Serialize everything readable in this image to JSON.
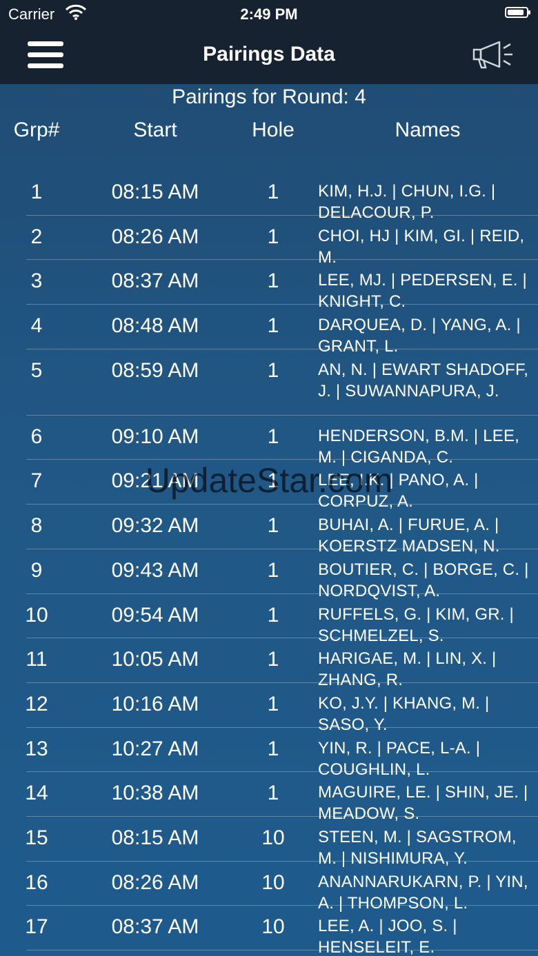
{
  "status": {
    "carrier": "Carrier",
    "time": "2:49 PM",
    "battery_level": 0.9
  },
  "nav": {
    "title": "Pairings Data",
    "menu_icon": "hamburger-menu-icon",
    "announce_icon": "megaphone-icon"
  },
  "round_title": "Pairings for Round: 4",
  "columns": {
    "grp": "Grp#",
    "start": "Start",
    "hole": "Hole",
    "names": "Names"
  },
  "pairings": [
    {
      "grp": "1",
      "start": "08:15 AM",
      "hole": "1",
      "names": "KIM, H.J. | CHUN, I.G. | DELACOUR, P."
    },
    {
      "grp": "2",
      "start": "08:26 AM",
      "hole": "1",
      "names": "CHOI, HJ | KIM, GI. | REID, M."
    },
    {
      "grp": "3",
      "start": "08:37 AM",
      "hole": "1",
      "names": "LEE, MJ. | PEDERSEN, E. | KNIGHT, C."
    },
    {
      "grp": "4",
      "start": "08:48 AM",
      "hole": "1",
      "names": "DARQUEA, D. | YANG, A. | GRANT, L."
    },
    {
      "grp": "5",
      "start": "08:59 AM",
      "hole": "1",
      "names": "AN, N. | EWART SHADOFF, J. | SUWANNAPURA, J."
    },
    {
      "grp": "6",
      "start": "09:10 AM",
      "hole": "1",
      "names": "HENDERSON, B.M. | LEE, M. | CIGANDA, C."
    },
    {
      "grp": "7",
      "start": "09:21 AM",
      "hole": "1",
      "names": "LEE, I.K. | PANO, A. | CORPUZ, A."
    },
    {
      "grp": "8",
      "start": "09:32 AM",
      "hole": "1",
      "names": "BUHAI, A. | FURUE, A. | KOERSTZ MADSEN, N."
    },
    {
      "grp": "9",
      "start": "09:43 AM",
      "hole": "1",
      "names": "BOUTIER, C. | BORGE, C. | NORDQVIST, A."
    },
    {
      "grp": "10",
      "start": "09:54 AM",
      "hole": "1",
      "names": "RUFFELS, G. | KIM, GR. | SCHMELZEL, S."
    },
    {
      "grp": "11",
      "start": "10:05 AM",
      "hole": "1",
      "names": "HARIGAE, M. | LIN, X. | ZHANG, R."
    },
    {
      "grp": "12",
      "start": "10:16 AM",
      "hole": "1",
      "names": "KO, J.Y. | KHANG, M. | SASO, Y."
    },
    {
      "grp": "13",
      "start": "10:27 AM",
      "hole": "1",
      "names": "YIN, R. | PACE, L-A. | COUGHLIN, L."
    },
    {
      "grp": "14",
      "start": "10:38 AM",
      "hole": "1",
      "names": "MAGUIRE, LE. | SHIN, JE. | MEADOW, S."
    },
    {
      "grp": "15",
      "start": "08:15 AM",
      "hole": "10",
      "names": "STEEN, M. | SAGSTROM, M. | NISHIMURA, Y."
    },
    {
      "grp": "16",
      "start": "08:26 AM",
      "hole": "10",
      "names": "ANANNARUKARN, P. | YIN, A. | THOMPSON, L."
    },
    {
      "grp": "17",
      "start": "08:37 AM",
      "hole": "10",
      "names": "LEE, A. | JOO, S. | HENSELEIT, E."
    }
  ],
  "watermark": "UpdateStar.com"
}
